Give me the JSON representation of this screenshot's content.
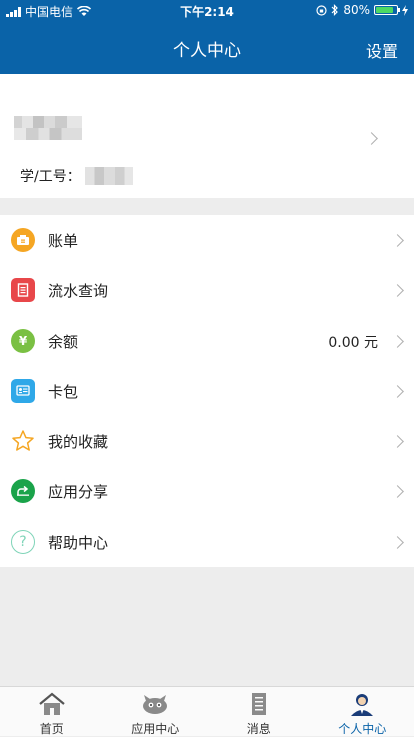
{
  "status_bar": {
    "carrier": "中国电信",
    "time": "下午2:14",
    "battery": "80%"
  },
  "nav": {
    "title": "个人中心",
    "settings_label": "设置"
  },
  "profile": {
    "id_label": "学/工号："
  },
  "menu": {
    "items": [
      {
        "label": "账单",
        "icon": "bill-icon",
        "color": "#f5a623"
      },
      {
        "label": "流水查询",
        "icon": "transaction-icon",
        "color": "#e8474a"
      },
      {
        "label": "余额",
        "icon": "balance-icon",
        "color": "#7ac043",
        "value": "0.00 元"
      },
      {
        "label": "卡包",
        "icon": "card-icon",
        "color": "#2fa8e8"
      },
      {
        "label": "我的收藏",
        "icon": "star-icon",
        "color": "#f5a623"
      },
      {
        "label": "应用分享",
        "icon": "share-icon",
        "color": "#1aa34a"
      },
      {
        "label": "帮助中心",
        "icon": "help-icon",
        "color": "#7fd4b8"
      }
    ]
  },
  "tabs": [
    {
      "label": "首页",
      "icon": "home-icon"
    },
    {
      "label": "应用中心",
      "icon": "app-center-icon"
    },
    {
      "label": "消息",
      "icon": "message-icon"
    },
    {
      "label": "个人中心",
      "icon": "user-icon",
      "active": true
    }
  ],
  "colors": {
    "brand": "#0a63a8",
    "background": "#ededed"
  }
}
